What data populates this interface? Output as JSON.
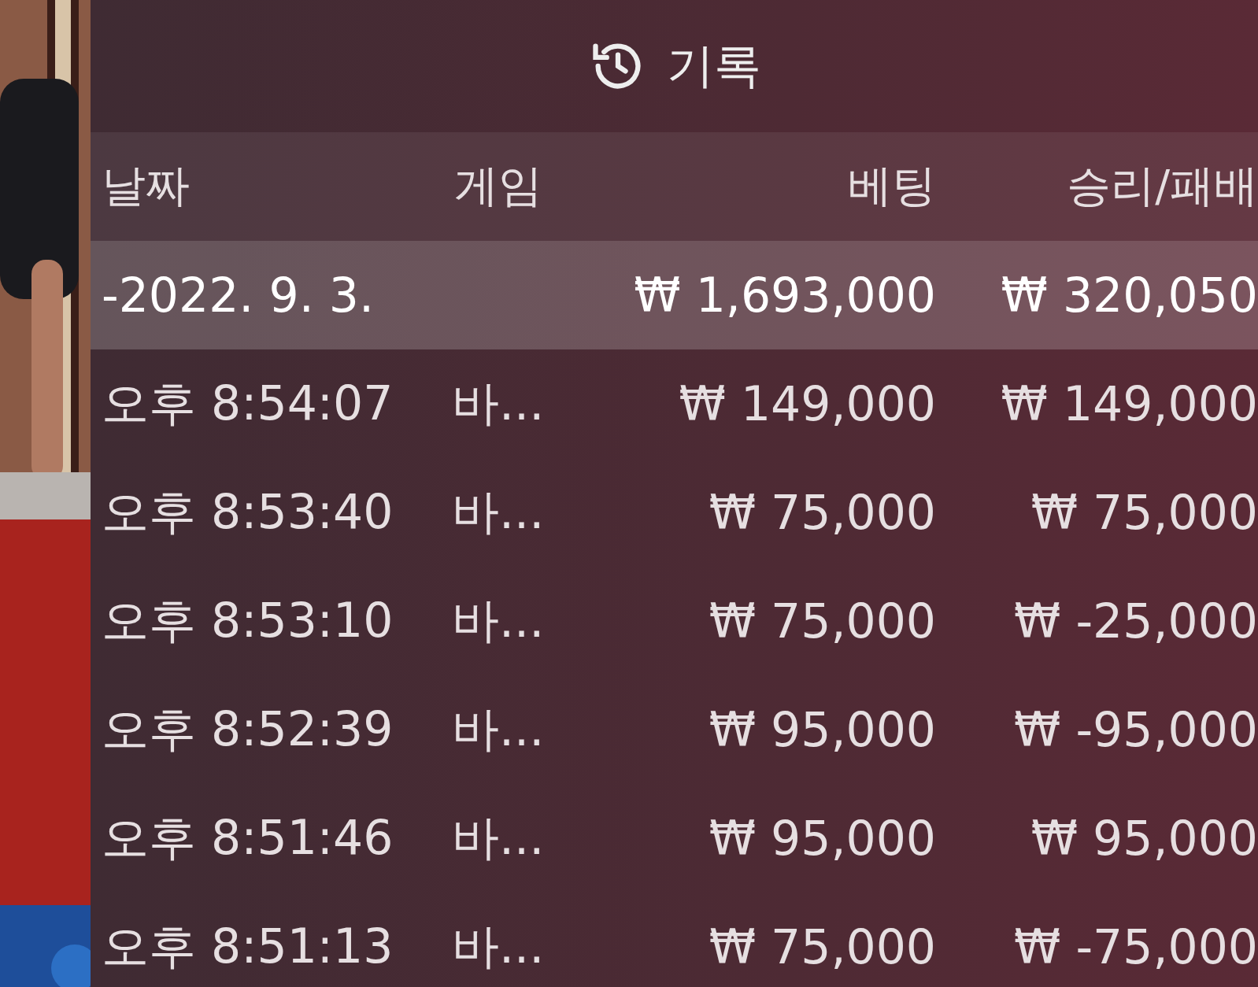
{
  "title": "기록",
  "table": {
    "columns": [
      "날짜",
      "게임",
      "베팅",
      "승리/패배"
    ],
    "rows": [
      {
        "kind": "date",
        "date": "-2022. 9. 3.",
        "bet": "₩ 1,693,000",
        "result": "₩ 320,050"
      },
      {
        "kind": "entry",
        "date": "오후 8:54:07",
        "game": "바...",
        "bet": "₩ 149,000",
        "result": "₩ 149,000"
      },
      {
        "kind": "entry",
        "date": "오후 8:53:40",
        "game": "바...",
        "bet": "₩ 75,000",
        "result": "₩ 75,000"
      },
      {
        "kind": "entry",
        "date": "오후 8:53:10",
        "game": "바...",
        "bet": "₩ 75,000",
        "result": "₩ -25,000"
      },
      {
        "kind": "entry",
        "date": "오후 8:52:39",
        "game": "바...",
        "bet": "₩ 95,000",
        "result": "₩ -95,000"
      },
      {
        "kind": "entry",
        "date": "오후 8:51:46",
        "game": "바...",
        "bet": "₩ 95,000",
        "result": "₩ 95,000"
      },
      {
        "kind": "entry",
        "date": "오후 8:51:13",
        "game": "바...",
        "bet": "₩ 75,000",
        "result": "₩ -75,000"
      }
    ]
  }
}
